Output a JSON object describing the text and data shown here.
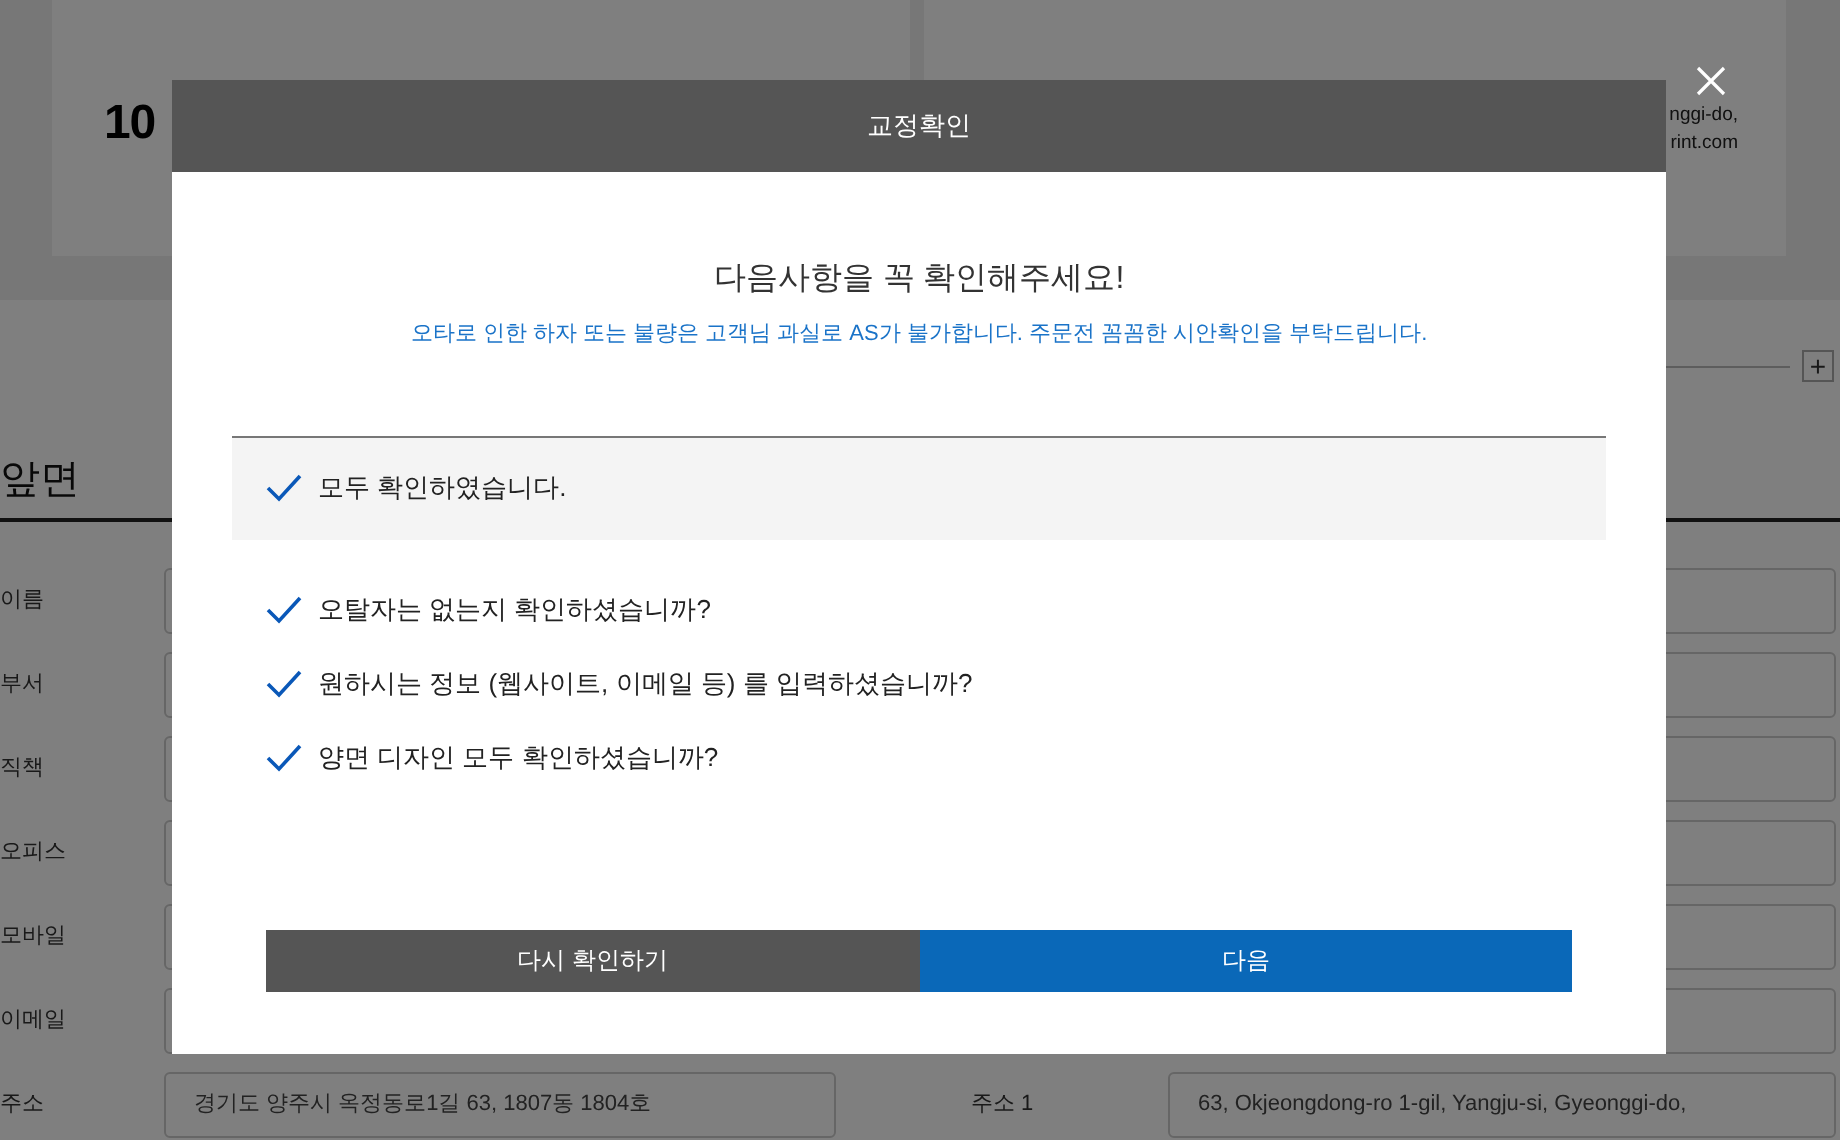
{
  "background": {
    "logo_text": "10",
    "card_lines": [
      "nggi-do,",
      "rint.com"
    ],
    "add_button": "+",
    "section_title": "앞면",
    "form_labels": [
      "이름",
      "부서",
      "직책",
      "오피스",
      "모바일",
      "이메일"
    ],
    "address": {
      "label": "주소",
      "value": "경기도 양주시 옥정동로1길 63, 1807동 1804호",
      "label_2": "주소 1",
      "value_2": "63, Okjeongdong-ro 1-gil, Yangju-si, Gyeonggi-do,"
    }
  },
  "dialog": {
    "title": "교정확인",
    "heading": "다음사항을 꼭 확인해주세요!",
    "notice": "오타로 인한 하자 또는 불량은 고객님 과실로 AS가 불가합니다. 주문전 꼼꼼한 시안확인을 부탁드립니다.",
    "confirm_all": {
      "label": "모두 확인하였습니다.",
      "checked": true
    },
    "checks": [
      {
        "label": "오탈자는 없는지 확인하셨습니까?",
        "checked": true
      },
      {
        "label": "원하시는 정보 (웹사이트, 이메일 등) 를 입력하셨습니까?",
        "checked": true
      },
      {
        "label": "양면 디자인 모두 확인하셨습니까?",
        "checked": true
      }
    ],
    "buttons": [
      {
        "label": "다시 확인하기",
        "kind": "secondary"
      },
      {
        "label": "다음",
        "kind": "primary"
      }
    ]
  }
}
